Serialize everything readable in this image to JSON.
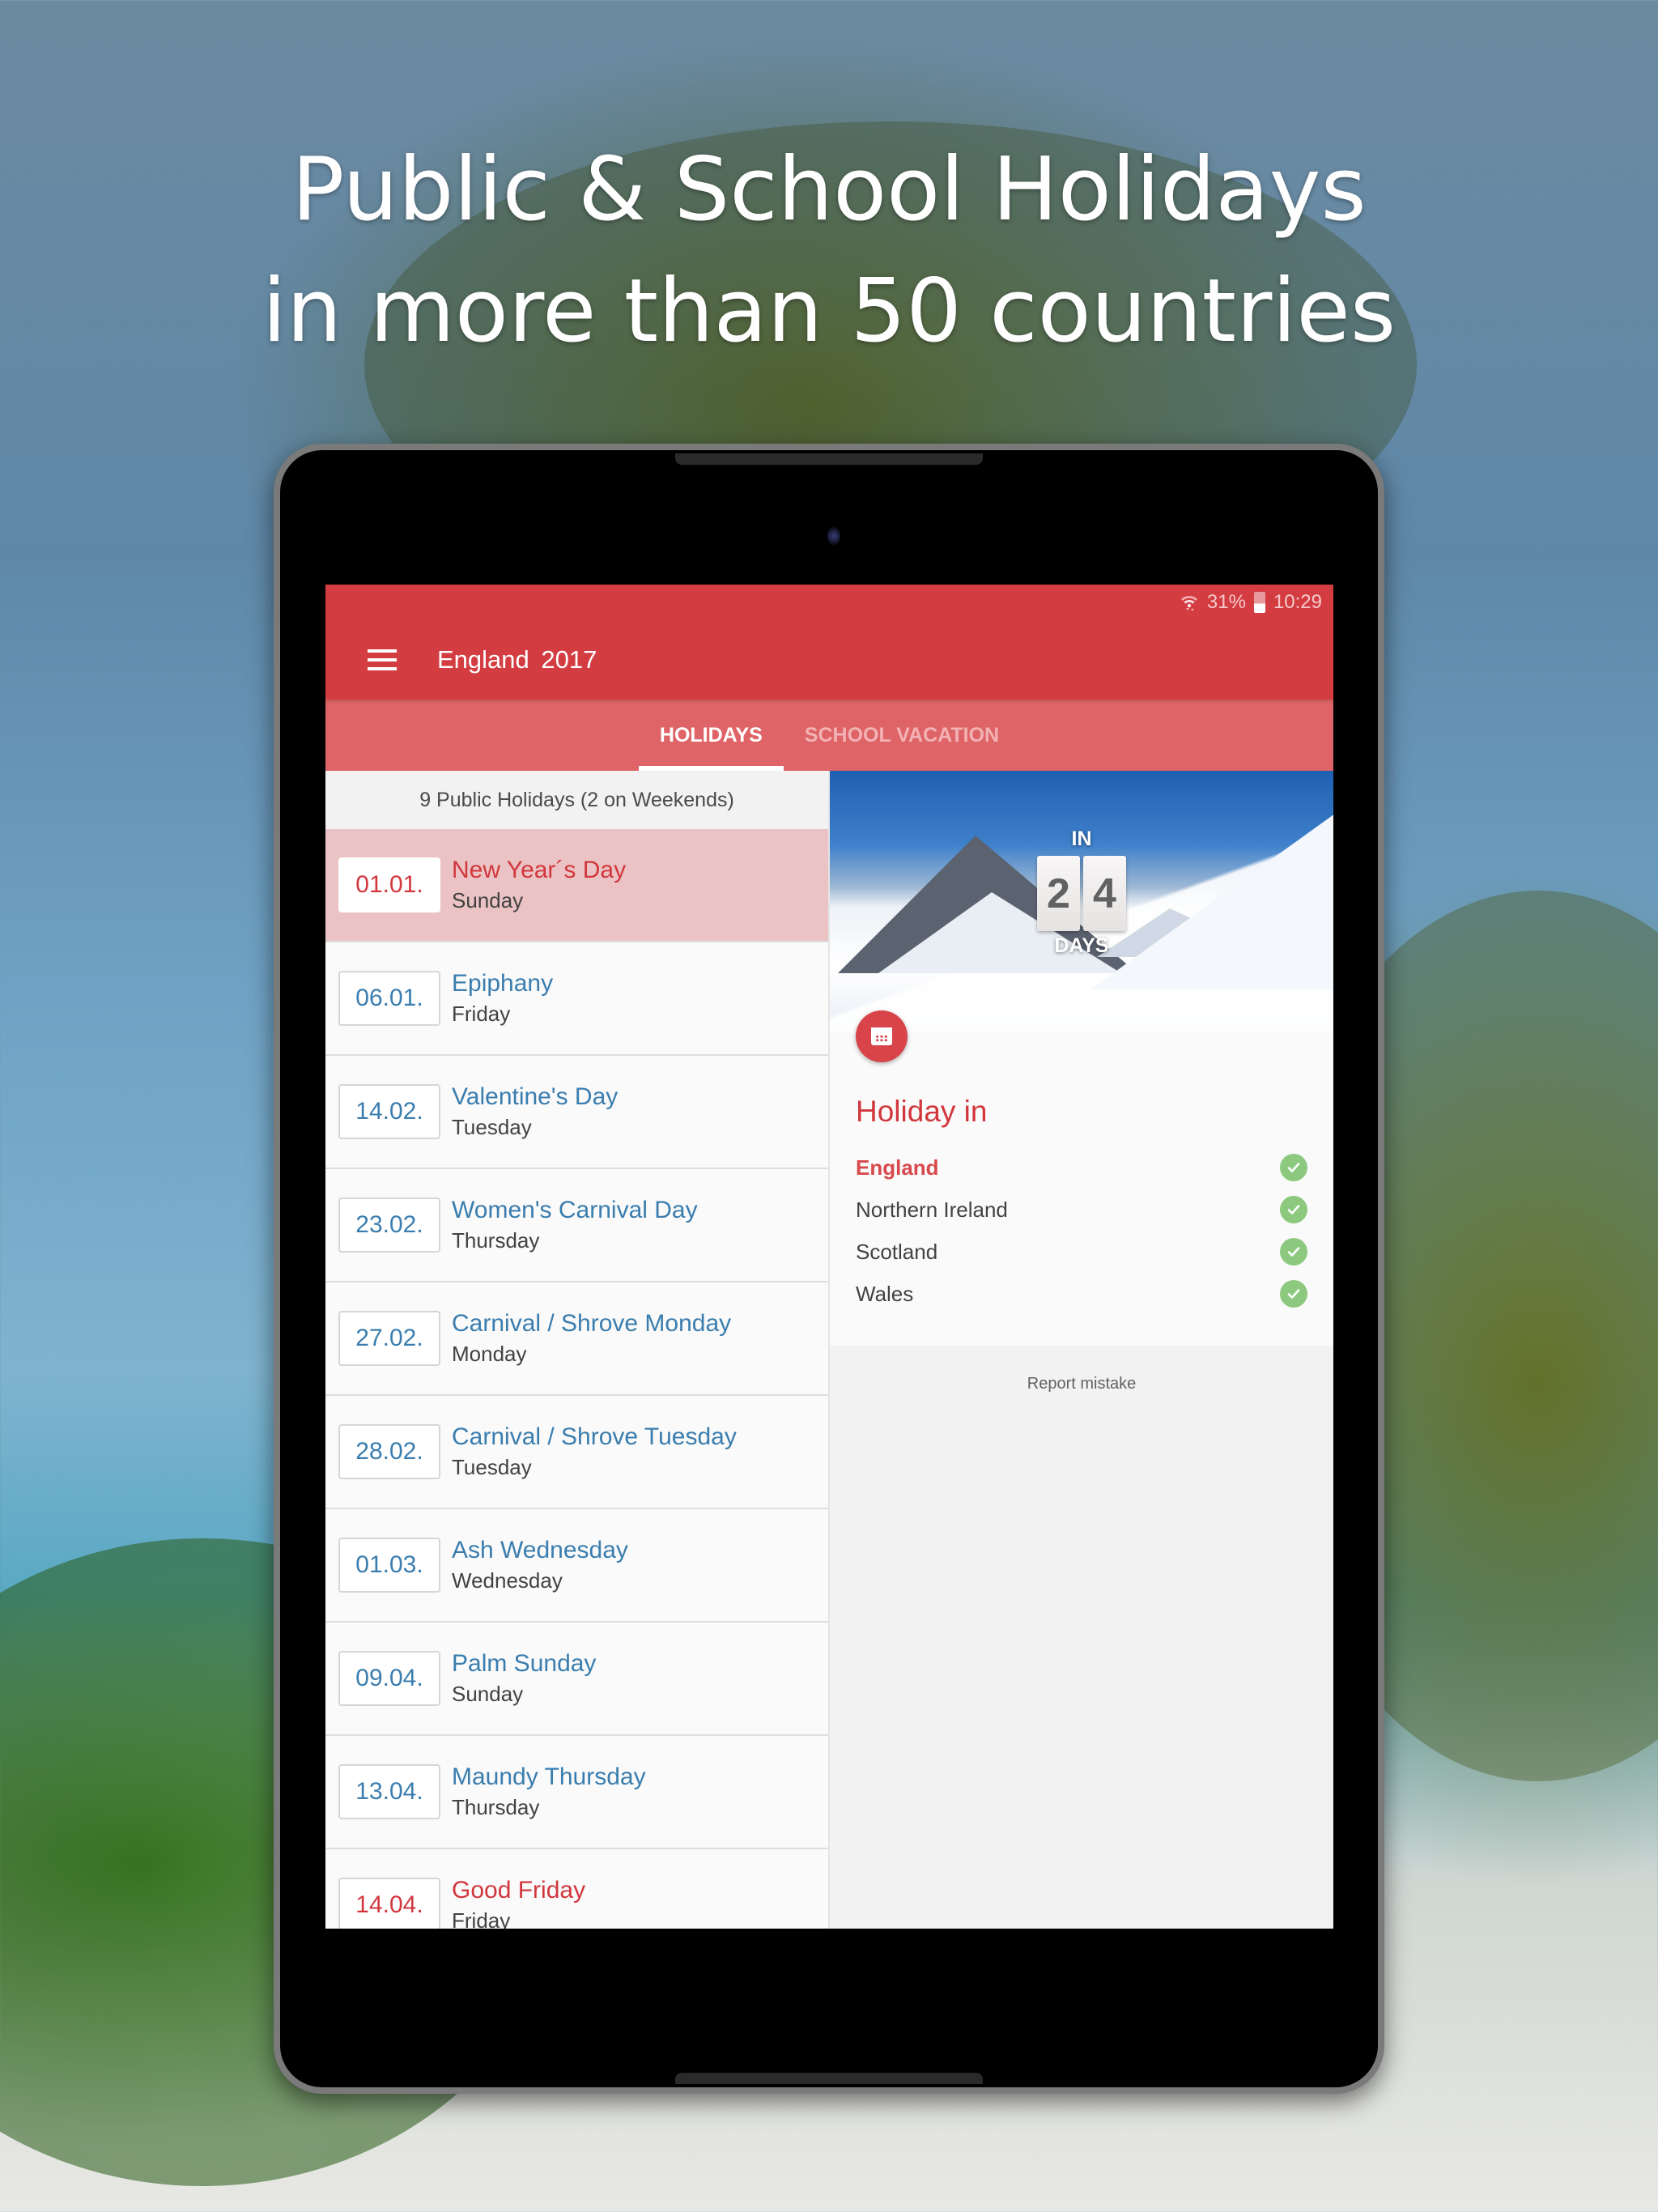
{
  "headline": {
    "line1": "Public & School Holidays",
    "line2": "in more than 50 countries"
  },
  "statusbar": {
    "wifi_icon": "wifi-icon",
    "battery_percent": "31%",
    "battery_icon": "battery-icon",
    "time": "10:29"
  },
  "appbar": {
    "menu_icon": "hamburger-menu-icon",
    "title": "England  2017"
  },
  "tabs": [
    {
      "label": "HOLIDAYS",
      "active": true
    },
    {
      "label": "SCHOOL VACATION",
      "active": false
    }
  ],
  "holidays": {
    "summary": "9 Public Holidays (2 on Weekends)",
    "items": [
      {
        "date": "01.01.",
        "name": "New Year´s Day",
        "day": "Sunday",
        "style": "public",
        "selected": true
      },
      {
        "date": "06.01.",
        "name": "Epiphany",
        "day": "Friday",
        "style": "observance",
        "selected": false
      },
      {
        "date": "14.02.",
        "name": "Valentine's Day",
        "day": "Tuesday",
        "style": "observance",
        "selected": false
      },
      {
        "date": "23.02.",
        "name": "Women's Carnival Day",
        "day": "Thursday",
        "style": "observance",
        "selected": false
      },
      {
        "date": "27.02.",
        "name": "Carnival / Shrove Monday",
        "day": "Monday",
        "style": "observance",
        "selected": false
      },
      {
        "date": "28.02.",
        "name": "Carnival / Shrove Tuesday",
        "day": "Tuesday",
        "style": "observance",
        "selected": false
      },
      {
        "date": "01.03.",
        "name": "Ash Wednesday",
        "day": "Wednesday",
        "style": "observance",
        "selected": false
      },
      {
        "date": "09.04.",
        "name": "Palm Sunday",
        "day": "Sunday",
        "style": "observance",
        "selected": false
      },
      {
        "date": "13.04.",
        "name": "Maundy Thursday",
        "day": "Thursday",
        "style": "observance",
        "selected": false
      },
      {
        "date": "14.04.",
        "name": "Good Friday",
        "day": "Friday",
        "style": "public",
        "selected": false
      }
    ]
  },
  "detail": {
    "countdown": {
      "prefix": "IN",
      "digits": [
        "2",
        "4"
      ],
      "suffix": "DAYS"
    },
    "fab_icon": "calendar-icon",
    "title": "Holiday in",
    "regions": [
      {
        "name": "England",
        "current": true,
        "is_holiday": true
      },
      {
        "name": "Northern Ireland",
        "current": false,
        "is_holiday": true
      },
      {
        "name": "Scotland",
        "current": false,
        "is_holiday": true
      },
      {
        "name": "Wales",
        "current": false,
        "is_holiday": true
      }
    ],
    "report_label": "Report mistake"
  },
  "colors": {
    "primary": "#d33d42",
    "tab_bar": "#de6467",
    "selected_row": "#ebc3c4",
    "public_holiday_text": "#d1373d",
    "observance_text": "#3a7dae",
    "check_green": "#8cc97e"
  }
}
